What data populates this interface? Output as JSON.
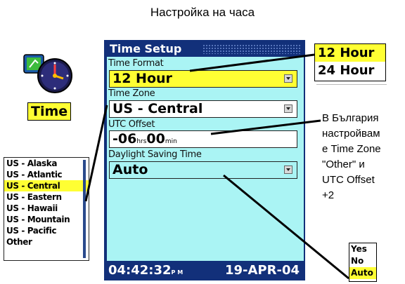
{
  "caption": "Настройка на часа",
  "app_icon": {
    "name": "clock-icon",
    "label": "Time"
  },
  "window": {
    "title": "Time Setup",
    "fields": {
      "time_format": {
        "label": "Time Format",
        "value": "12 Hour"
      },
      "time_zone": {
        "label": "Time Zone",
        "value": "US - Central"
      },
      "utc_offset": {
        "label": "UTC Offset",
        "hours": "-06",
        "hours_unit": "hrs",
        "minutes": "00",
        "minutes_unit": "min"
      },
      "dst": {
        "label": "Daylight Saving Time",
        "value": "Auto"
      }
    },
    "status": {
      "time": "04:42:32",
      "ampm": "P M",
      "date": "19-APR-04"
    }
  },
  "time_format_options": {
    "items": [
      "12 Hour",
      "24 Hour"
    ],
    "selected": "12 Hour"
  },
  "time_zone_options": {
    "items": [
      "US - Alaska",
      "US - Atlantic",
      "US - Central",
      "US - Eastern",
      "US - Hawaii",
      "US - Mountain",
      "US - Pacific",
      "Other"
    ],
    "selected": "US - Central"
  },
  "dst_options": {
    "items": [
      "Yes",
      "No",
      "Auto"
    ],
    "selected": "Auto"
  },
  "note": {
    "lines": [
      "В България",
      "настройвам",
      "е Time Zone",
      "\"Other\" и",
      "UTC Offset",
      "+2"
    ]
  },
  "colors": {
    "frame": "#12307a",
    "panel": "#aaf4f4",
    "highlight": "#ffff33"
  }
}
